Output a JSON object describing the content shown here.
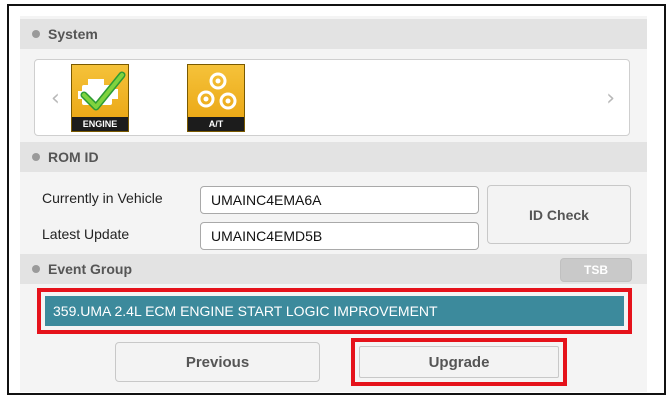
{
  "sections": {
    "system": "System",
    "rom_id": "ROM ID",
    "event_group": "Event Group"
  },
  "systems": [
    {
      "label": "ENGINE",
      "icon": "engine-check-icon",
      "selected": true
    },
    {
      "label": "A/T",
      "icon": "gears-icon",
      "selected": false
    }
  ],
  "rom": {
    "currently_label": "Currently in Vehicle",
    "currently_value": "UMAINC4EMA6A",
    "latest_label": "Latest Update",
    "latest_value": "UMAINC4EMD5B",
    "id_check": "ID Check"
  },
  "event": {
    "tsb": "TSB",
    "selected_item": "359.UMA 2.4L ECM ENGINE START LOGIC IMPROVEMENT"
  },
  "buttons": {
    "previous": "Previous",
    "upgrade": "Upgrade"
  },
  "colors": {
    "highlight_red": "#e5121b",
    "event_row": "#3c8a9c",
    "icon_gold": "#f0b426"
  }
}
